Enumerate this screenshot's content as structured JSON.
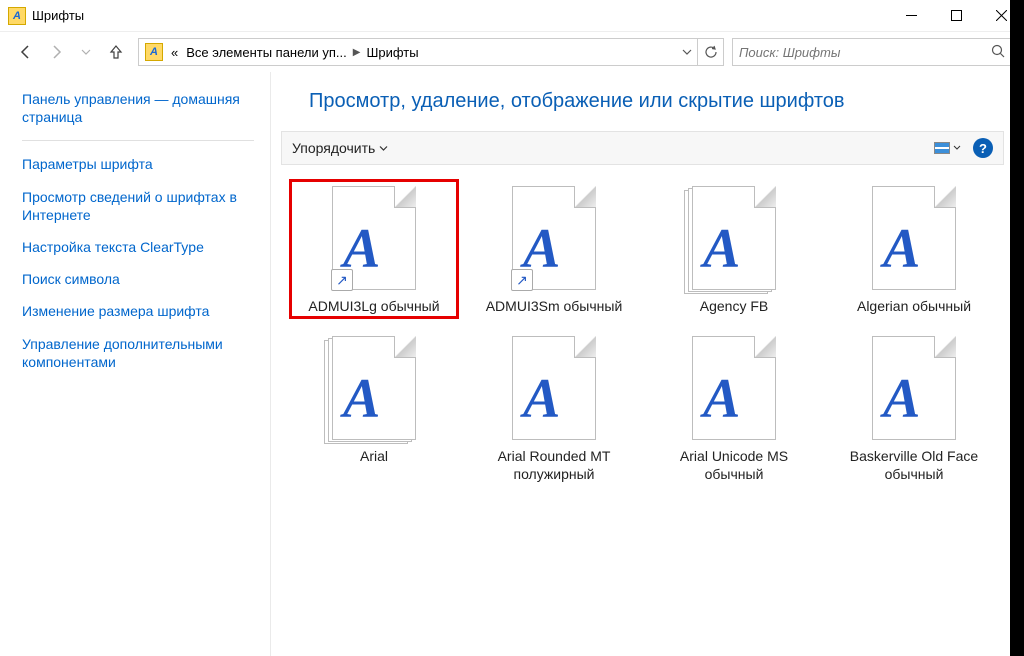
{
  "window": {
    "title": "Шрифты"
  },
  "breadcrumb": {
    "prefix": "«",
    "part1": "Все элементы панели уп...",
    "part2": "Шрифты"
  },
  "search": {
    "placeholder": "Поиск: Шрифты"
  },
  "sidebar": {
    "home": "Панель управления — домашняя страница",
    "links": [
      "Параметры шрифта",
      "Просмотр сведений о шрифтах в Интернете",
      "Настройка текста ClearType",
      "Поиск символа",
      "Изменение размера шрифта",
      "Управление дополнительными компонентами"
    ]
  },
  "heading": "Просмотр, удаление, отображение или скрытие шрифтов",
  "toolbar": {
    "organize": "Упорядочить",
    "help": "?"
  },
  "fonts": [
    {
      "name": "ADMUI3Lg обычный",
      "stack": false,
      "shortcut": true,
      "highlighted": true
    },
    {
      "name": "ADMUI3Sm обычный",
      "stack": false,
      "shortcut": true,
      "highlighted": false
    },
    {
      "name": "Agency FB",
      "stack": true,
      "shortcut": false,
      "highlighted": false
    },
    {
      "name": "Algerian обычный",
      "stack": false,
      "shortcut": false,
      "highlighted": false
    },
    {
      "name": "Arial",
      "stack": true,
      "shortcut": false,
      "highlighted": false
    },
    {
      "name": "Arial Rounded MT полужирный",
      "stack": false,
      "shortcut": false,
      "highlighted": false
    },
    {
      "name": "Arial Unicode MS обычный",
      "stack": false,
      "shortcut": false,
      "highlighted": false
    },
    {
      "name": "Baskerville Old Face обычный",
      "stack": false,
      "shortcut": false,
      "highlighted": false
    }
  ],
  "glyph": "A"
}
